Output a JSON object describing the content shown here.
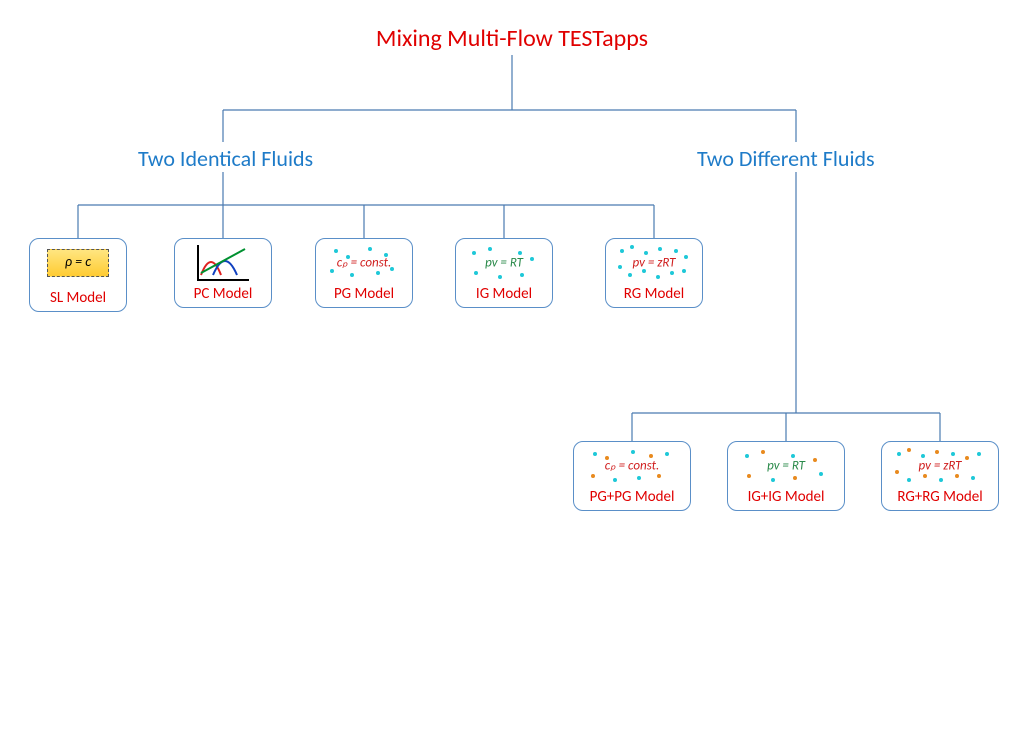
{
  "title": "Mixing Multi-Flow TESTapps",
  "branches": {
    "identical": "Two Identical Fluids",
    "different": "Two Different Fluids"
  },
  "models": {
    "sl": {
      "label": "SL Model",
      "formula": "ρ = c"
    },
    "pc": {
      "label": "PC Model"
    },
    "pg": {
      "label": "PG Model",
      "formula": "cₚ = const."
    },
    "ig": {
      "label": "IG Model",
      "formula": "pv = RT"
    },
    "rg": {
      "label": "RG Model",
      "formula": "pv = zRT"
    },
    "pgpg": {
      "label": "PG+PG Model",
      "formula": "cₚ = const."
    },
    "igig": {
      "label": "IG+IG Model",
      "formula": "pv = RT"
    },
    "rgrg": {
      "label": "RG+RG Model",
      "formula": "pv = zRT"
    }
  }
}
